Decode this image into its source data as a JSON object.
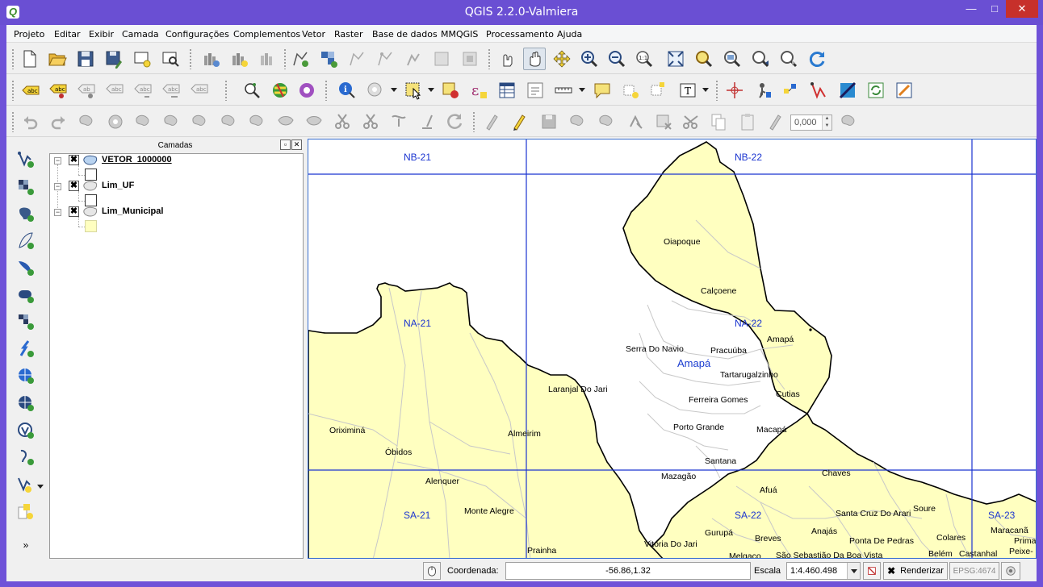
{
  "window": {
    "title": "QGIS 2.2.0-Valmiera",
    "app_icon": "Q"
  },
  "menu": [
    "Projeto",
    "Editar",
    "Exibir",
    "Camada",
    "Configurações",
    "Complementos",
    "Vetor",
    "Raster",
    "Base de dados",
    "MMQGIS",
    "Processamento",
    "Ajuda"
  ],
  "toolbar": {
    "snap_value": "0,000"
  },
  "layers_panel": {
    "title": "Camadas",
    "layers": [
      {
        "name": "VETOR_1000000",
        "checked": "✖",
        "active": true,
        "swatch": "#ffffff"
      },
      {
        "name": "Lim_UF",
        "checked": "✖",
        "active": false,
        "swatch": "#ffffff"
      },
      {
        "name": "Lim_Municipal",
        "checked": "✖",
        "active": false,
        "swatch": "#ffffc0"
      }
    ]
  },
  "map": {
    "grid_labels": [
      "NB-21",
      "NB-22",
      "NA-21",
      "NA-22",
      "SA-21",
      "SA-22",
      "SA-23"
    ],
    "state_label": "Amapá",
    "municipalities": [
      "Oiapoque",
      "Calçoene",
      "Amapá",
      "Serra Do Navio",
      "Pracuúba",
      "Tartarugalzinho",
      "Laranjal Do Jari",
      "Ferreira Gomes",
      "Cutias",
      "Porto Grande",
      "Macapá",
      "Santana",
      "Mazagão",
      "Oriximiná",
      "Óbidos",
      "Almeirim",
      "Alenquer",
      "Monte Alegre",
      "Prainha",
      "Vitória Do Jari",
      "Gurupá",
      "Afuá",
      "Chaves",
      "Santa Cruz Do Arari",
      "Soure",
      "Anajás",
      "Ponta De Pedras",
      "Breves",
      "Colares",
      "São Sebastião Da Boa Vista",
      "Melgaço",
      "Belém",
      "Castanhal",
      "Maracanã",
      "Prima",
      "Peixe-"
    ],
    "colors": {
      "land": "#ffffc0",
      "grid": "#1a34d0",
      "boundary": "#000000",
      "muni_border": "#c8c8c8"
    }
  },
  "statusbar": {
    "coord_label": "Coordenada:",
    "coord_value": "-56.86,1.32",
    "scale_label": "Escala",
    "scale_value": "1:4.460.498",
    "render_label": "Renderizar",
    "epsg_label": "EPSG:4674"
  }
}
